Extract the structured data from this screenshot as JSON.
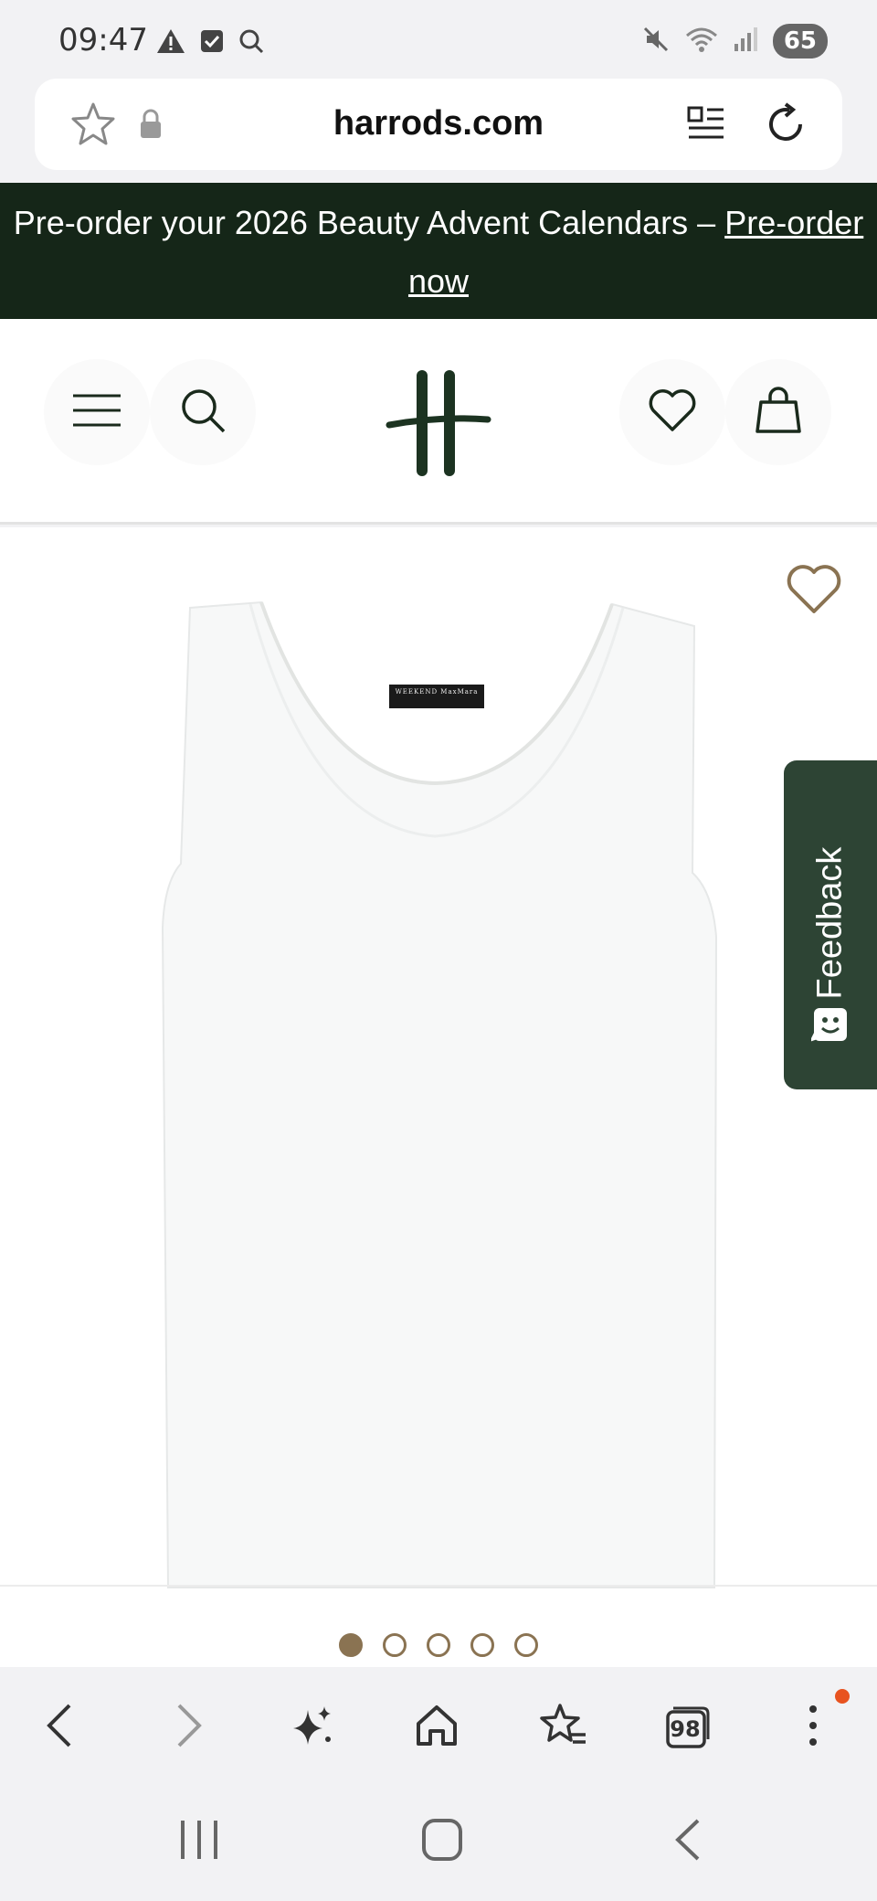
{
  "status_bar": {
    "time": "09:47",
    "battery": "65",
    "left_icons": [
      "warning-icon",
      "checkbox-icon",
      "search-icon"
    ],
    "right_icons": [
      "mute-icon",
      "wifi-icon",
      "signal-icon",
      "battery-icon"
    ]
  },
  "browser": {
    "url": "harrods.com",
    "tabs_count": "98"
  },
  "promo": {
    "text": "Pre-order your 2026 Beauty Advent Calendars – ",
    "link": "Pre-order now"
  },
  "product": {
    "image_label": "WEEKEND MaxMara",
    "carousel_total": 5,
    "carousel_active": 1
  },
  "feedback": {
    "label": "Feedback"
  },
  "colors": {
    "promo_bg": "#152618",
    "brand_green": "#1c3321",
    "accent_gold": "#8a7352",
    "feedback_bg": "#2d4434",
    "notification": "#e8531f"
  }
}
